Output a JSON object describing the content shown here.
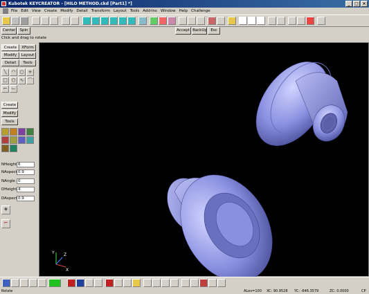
{
  "window": {
    "title": "Kubotek KEYCREATOR - [HILO METHOD.ckd [Part1] *]",
    "buttons": [
      "_",
      "□",
      "×"
    ]
  },
  "menu": [
    "File",
    "Edit",
    "View",
    "Create",
    "Modify",
    "Detail",
    "Transform",
    "Layout",
    "Tools",
    "Add-Ins",
    "Window",
    "Help",
    "Challenge"
  ],
  "row2": {
    "center": "Center",
    "spin": "Spin",
    "accept": "Accept",
    "backup": "BackUp",
    "esc": "Esc"
  },
  "hint": "Click and drag to rotate",
  "left_tabs_top": {
    "create": "Create",
    "xform": "XForm",
    "modify": "Modify",
    "layout": "Layout",
    "detail": "Detail",
    "tools": "Tools"
  },
  "left_tabs_mid": {
    "create": "Create",
    "modify": "Modify",
    "tools": "Tools"
  },
  "fields": [
    {
      "label": "NHeight",
      "value": "6"
    },
    {
      "label": "NAspect",
      "value": "0.9"
    },
    {
      "label": "NAngle",
      "value": "0"
    },
    {
      "label": "DHeight",
      "value": "4"
    },
    {
      "label": "DAspect",
      "value": "0.9"
    }
  ],
  "axis": {
    "x": "X",
    "y": "Y",
    "z": "Z"
  },
  "status": {
    "left": "Rotate",
    "alev": "ALev=100",
    "xc": "XC: 90.9528",
    "yc": "YC: -646.3579",
    "zc": "ZC: 0.0000",
    "cp": "CP"
  }
}
